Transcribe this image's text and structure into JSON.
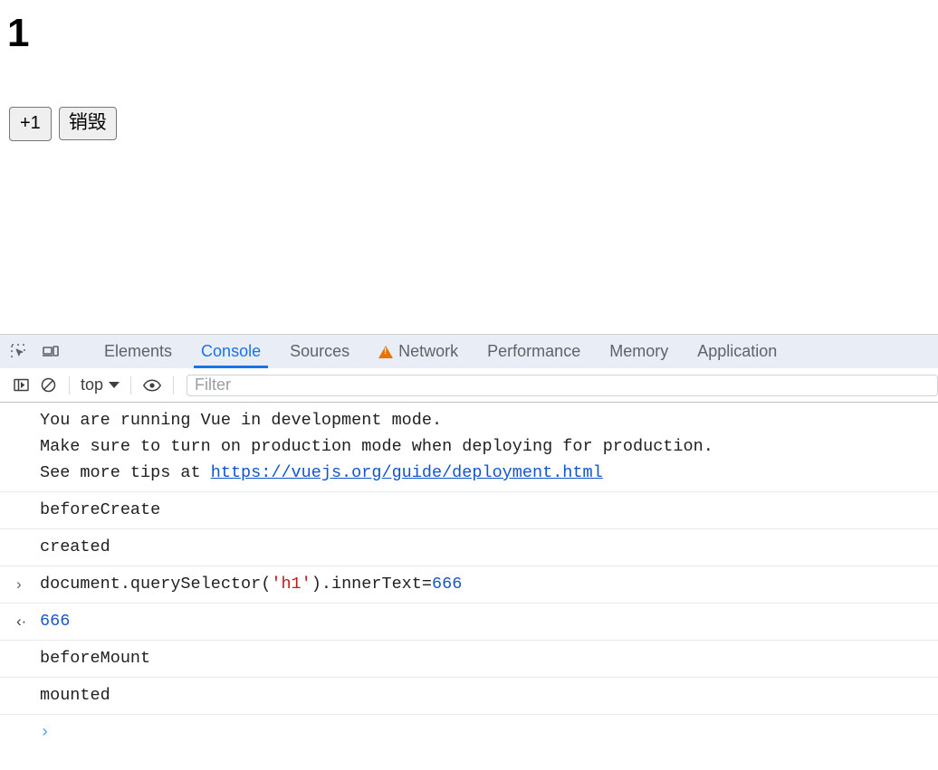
{
  "page": {
    "heading": "1",
    "buttons": [
      {
        "label": "+1",
        "name": "increment-button"
      },
      {
        "label": "销毁",
        "name": "destroy-button"
      }
    ]
  },
  "devtools": {
    "toolbar_icons": [
      {
        "name": "inspect-element-icon",
        "title": "Inspect element"
      },
      {
        "name": "device-toolbar-icon",
        "title": "Toggle device toolbar"
      }
    ],
    "tabs": [
      {
        "label": "Elements",
        "active": false,
        "warning": false
      },
      {
        "label": "Console",
        "active": true,
        "warning": false
      },
      {
        "label": "Sources",
        "active": false,
        "warning": false
      },
      {
        "label": "Network",
        "active": false,
        "warning": true
      },
      {
        "label": "Performance",
        "active": false,
        "warning": false
      },
      {
        "label": "Memory",
        "active": false,
        "warning": false
      },
      {
        "label": "Application",
        "active": false,
        "warning": false
      }
    ],
    "console_toolbar": {
      "sidebar_toggle": "show-console-sidebar-icon",
      "clear_console": "clear-console-icon",
      "context": "top",
      "eye": "live-expression-icon",
      "filter_placeholder": "Filter",
      "filter_value": ""
    },
    "messages": [
      {
        "type": "warning-text",
        "gutter": "",
        "lines": [
          "You are running Vue in development mode.",
          "Make sure to turn on production mode when deploying for production.",
          "See more tips at "
        ],
        "link": "https://vuejs.org/guide/deployment.html"
      },
      {
        "type": "log",
        "gutter": "",
        "text": "beforeCreate"
      },
      {
        "type": "log",
        "gutter": "",
        "text": "created"
      },
      {
        "type": "input",
        "gutter": "›",
        "prefix": "document.querySelector(",
        "string": "'h1'",
        "middle": ").innerText=",
        "number": "666"
      },
      {
        "type": "output",
        "gutter": "‹·",
        "value": "666"
      },
      {
        "type": "log",
        "gutter": "",
        "text": "beforeMount"
      },
      {
        "type": "log",
        "gutter": "",
        "text": "mounted"
      }
    ],
    "prompt": "›"
  },
  "colors": {
    "accent": "#1a73e8",
    "warning": "#e8710a",
    "link": "#1155cc",
    "string": "#c41a16",
    "number": "#1a56c4",
    "tabbar_bg": "#e9eef6"
  }
}
